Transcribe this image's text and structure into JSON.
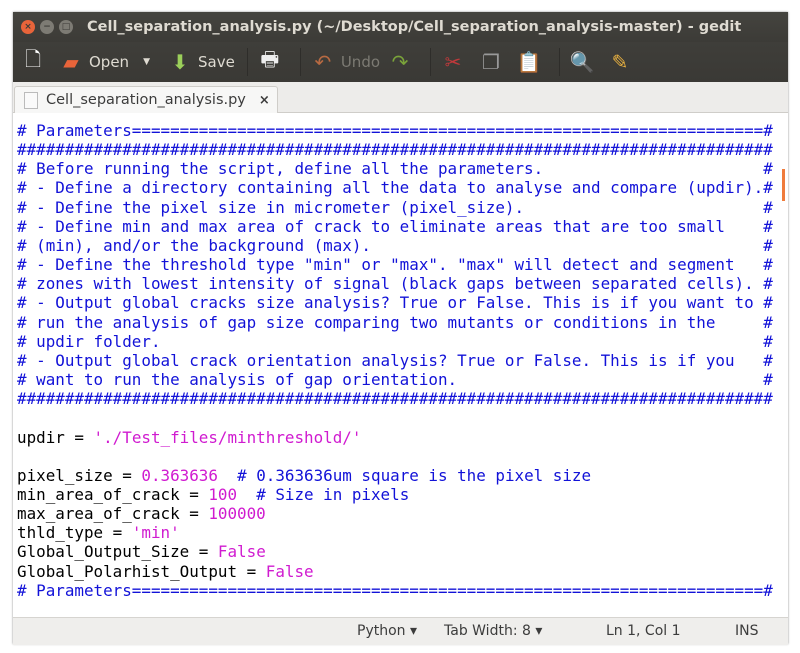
{
  "window": {
    "title": "Cell_separation_analysis.py (~/Desktop/Cell_separation_analysis-master) - gedit",
    "controls": [
      "close",
      "minimize",
      "maximize"
    ]
  },
  "toolbar": {
    "new_icon": "new-document-icon",
    "open_label": "Open",
    "save_label": "Save",
    "undo_label": "Undo",
    "icons": [
      "new-document-icon",
      "open-folder-icon",
      "save-icon",
      "print-icon",
      "undo-icon",
      "redo-icon",
      "cut-icon",
      "copy-icon",
      "paste-icon",
      "search-icon",
      "replace-icon"
    ]
  },
  "tab": {
    "label": "Cell_separation_analysis.py",
    "close": "×"
  },
  "editor": {
    "pad_width": 78,
    "lines": [
      [
        {
          "t": "c",
          "v": "# Parameters==================================================================#"
        }
      ],
      [
        {
          "t": "c",
          "v": "###############################################################################"
        }
      ],
      [
        {
          "t": "c",
          "v": "# Before running the script, define all the parameters.",
          "end": "#"
        }
      ],
      [
        {
          "t": "c",
          "v": "# - Define a directory containing all the data to analyse and compare (updir).#"
        }
      ],
      [
        {
          "t": "c",
          "v": "# - Define the pixel size in micrometer (pixel_size).",
          "end": "#"
        }
      ],
      [
        {
          "t": "c",
          "v": "# - Define min and max area of crack to eliminate areas that are too small",
          "end": "#"
        }
      ],
      [
        {
          "t": "c",
          "v": "# (min), and/or the background (max).",
          "end": "#"
        }
      ],
      [
        {
          "t": "c",
          "v": "# - Define the threshold type \"min\" or \"max\". \"max\" will detect and segment",
          "end": "#"
        }
      ],
      [
        {
          "t": "c",
          "v": "# zones with lowest intensity of signal (black gaps between separated cells).",
          "end": "#"
        }
      ],
      [
        {
          "t": "c",
          "v": "# - Output global cracks size analysis? True or False. This is if you want to",
          "end": "#"
        }
      ],
      [
        {
          "t": "c",
          "v": "# run the analysis of gap size comparing two mutants or conditions in the",
          "end": "#"
        }
      ],
      [
        {
          "t": "c",
          "v": "# updir folder.",
          "end": "#"
        }
      ],
      [
        {
          "t": "c",
          "v": "# - Output global crack orientation analysis? True or False. This is if you",
          "end": "#"
        }
      ],
      [
        {
          "t": "c",
          "v": "# want to run the analysis of gap orientation.",
          "end": "#"
        }
      ],
      [
        {
          "t": "c",
          "v": "###############################################################################"
        }
      ],
      [],
      [
        {
          "t": "p",
          "v": "updir = "
        },
        {
          "t": "s",
          "v": "'./Test_files/minthreshold/'"
        }
      ],
      [],
      [
        {
          "t": "p",
          "v": "pixel_size = "
        },
        {
          "t": "n",
          "v": "0.363636"
        },
        {
          "t": "p",
          "v": "  "
        },
        {
          "t": "c",
          "v": "# 0.363636um square is the pixel size"
        }
      ],
      [
        {
          "t": "p",
          "v": "min_area_of_crack = "
        },
        {
          "t": "n",
          "v": "100"
        },
        {
          "t": "p",
          "v": "  "
        },
        {
          "t": "c",
          "v": "# Size in pixels"
        }
      ],
      [
        {
          "t": "p",
          "v": "max_area_of_crack = "
        },
        {
          "t": "n",
          "v": "100000"
        }
      ],
      [
        {
          "t": "p",
          "v": "thld_type = "
        },
        {
          "t": "s",
          "v": "'min'"
        }
      ],
      [
        {
          "t": "p",
          "v": "Global_Output_Size = "
        },
        {
          "t": "k",
          "v": "False"
        }
      ],
      [
        {
          "t": "p",
          "v": "Global_Polarhist_Output = "
        },
        {
          "t": "k",
          "v": "False"
        }
      ],
      [
        {
          "t": "c",
          "v": "# Parameters==================================================================#"
        }
      ]
    ]
  },
  "statusbar": {
    "language": "Python ▾",
    "tab_width": "Tab Width: 8 ▾",
    "position": "Ln 1, Col 1",
    "mode": "INS"
  },
  "colors": {
    "comment": "#1212d8",
    "literal": "#d01bd0",
    "scroll_marker": "#f07c3c",
    "titlebar": "#3c3b37"
  }
}
